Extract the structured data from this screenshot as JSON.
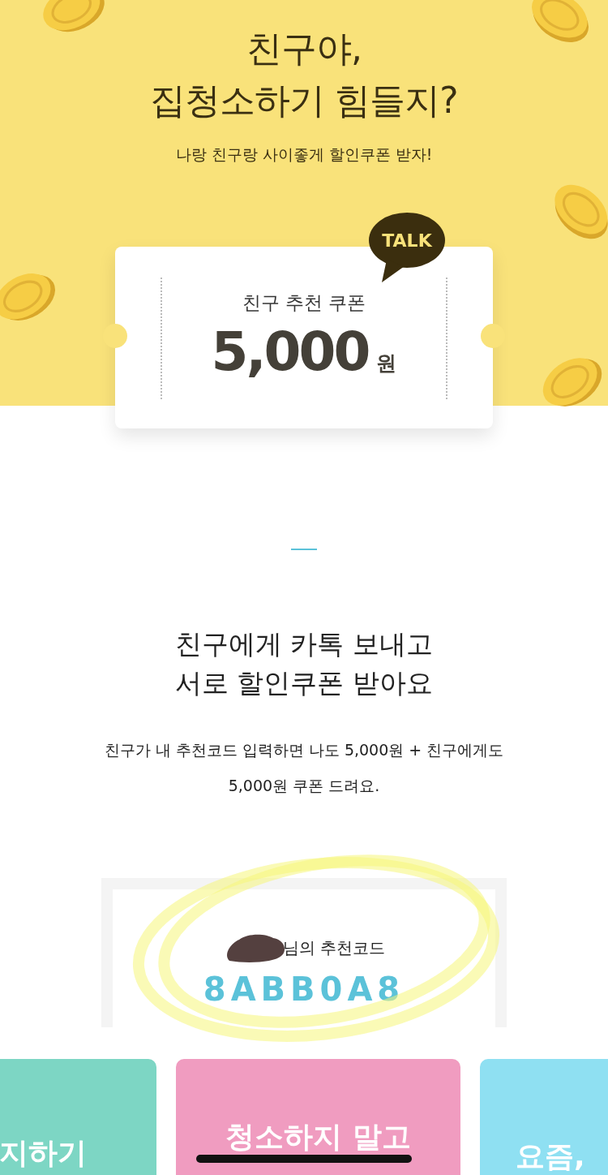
{
  "hero": {
    "title_lines": [
      "친구야,",
      "집청소하기 힘들지?"
    ],
    "subtitle": "나랑 친구랑 사이좋게 할인쿠폰 받자!"
  },
  "coupon": {
    "badge": "TALK",
    "label": "친구 추천 쿠폰",
    "amount": "5,000",
    "unit": "원"
  },
  "intro": {
    "heading_lines": [
      "친구에게 카톡 보내고",
      "서로 할인쿠폰 받아요"
    ],
    "body": "친구가 내 추천코드 입력하면 나도 5,000원 + 친구에게도 5,000원 쿠폰 드려요."
  },
  "referral": {
    "label": "님의 추천코드",
    "code": "8ABB0A8",
    "name_redacted": true
  },
  "banners": [
    {
      "text": "지하기",
      "color": "#7dd6c4"
    },
    {
      "text": "청소하지 말고",
      "color": "#f09cc0"
    },
    {
      "text": "요즘,",
      "color": "#8fe0f2"
    }
  ]
}
